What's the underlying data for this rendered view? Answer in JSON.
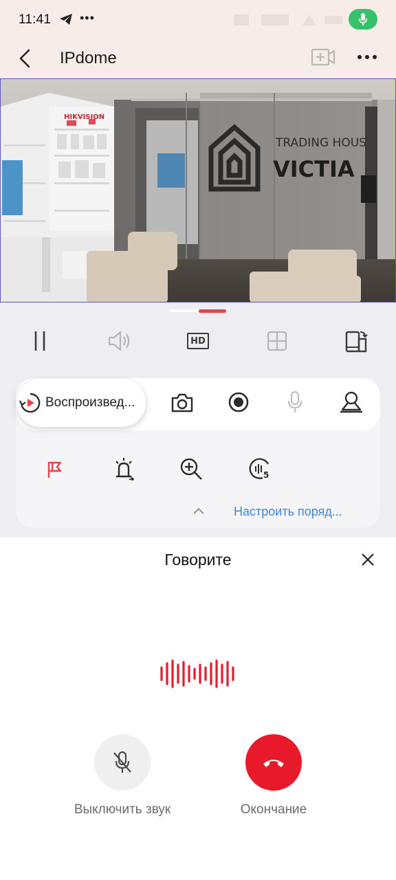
{
  "status_bar": {
    "time": "11:41",
    "icons": [
      "telegram-icon",
      "more-notifications-icon",
      "mic-active-icon"
    ],
    "mic_pill_color": "#34c36b"
  },
  "header": {
    "title": "IPdome",
    "icons": [
      "back-arrow-icon",
      "add-camera-icon",
      "more-options-icon"
    ]
  },
  "video": {
    "overlay_text": [
      "HIKVISION",
      "TRADING HOUSE",
      "VICTIA"
    ]
  },
  "controls": {
    "icons": [
      "pause-icon",
      "volume-icon",
      "hd-icon",
      "multi-view-icon",
      "rotate-screen-icon"
    ],
    "hd_label": "HD",
    "accent": "#e8424a"
  },
  "toolbar": {
    "playback_label": "Воспроизвед...",
    "icons": [
      "playback-icon",
      "camera-snapshot-icon",
      "record-icon",
      "microphone-icon",
      "ptz-icon"
    ]
  },
  "tools": {
    "icons": [
      "alarm-flag-icon",
      "siren-light-icon",
      "zoom-in-icon",
      "sensitivity-icon"
    ],
    "sensitivity_value": "5",
    "customize_label": "Настроить поряд..."
  },
  "talk_sheet": {
    "title": "Говорите",
    "mute_label": "Выключить звук",
    "end_label": "Окончание",
    "wave_color": "#e8192b",
    "end_color": "#e8192b"
  }
}
